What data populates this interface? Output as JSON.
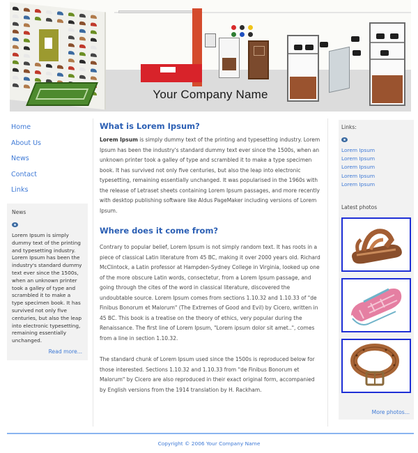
{
  "header": {
    "company_name": "Your Company Name"
  },
  "nav": {
    "items": [
      {
        "label": "Home"
      },
      {
        "label": "About Us"
      },
      {
        "label": "News"
      },
      {
        "label": "Contact"
      },
      {
        "label": "Links"
      }
    ]
  },
  "news_box": {
    "title": "News",
    "icon": "rss-icon",
    "text": "Lorem Ipsum is simply dummy text of the printing and typesetting industry. Lorem Ipsum has been the industry's standard dummy text ever since the 1500s, when an unknown printer took a galley of type and scrambled it to make a type specimen book. It has survived not only five centuries, but also the leap into electronic typesetting, remaining essentially unchanged.",
    "read_more": "Read more..."
  },
  "main": {
    "section1": {
      "heading": "What is Lorem Ipsum?",
      "lead": "Lorem Ipsum",
      "body": " is simply dummy text of the printing and typesetting industry. Lorem Ipsum has been the industry's standard dummy text ever since the 1500s, when an unknown printer took a galley of type and scrambled it to make a type specimen book. It has survived not only five centuries, but also the leap into electronic typesetting, remaining essentially unchanged. It was popularised in the 1960s with the release of Letraset sheets containing Lorem Ipsum passages, and more recently with desktop publishing software like Aldus PageMaker including versions of Lorem Ipsum."
    },
    "section2": {
      "heading": "Where does it come from?",
      "para1": "Contrary to popular belief, Lorem Ipsum is not simply random text. It has roots in a piece of classical Latin literature from 45 BC, making it over 2000 years old. Richard McClintock, a Latin professor at Hampden-Sydney College in Virginia, looked up one of the more obscure Latin words, consectetur, from a Lorem Ipsum passage, and going through the cites of the word in classical literature, discovered the undoubtable source. Lorem Ipsum comes from sections 1.10.32 and 1.10.33 of \"de Finibus Bonorum et Malorum\" (The Extremes of Good and Evil) by Cicero, written in 45 BC. This book is a treatise on the theory of ethics, very popular during the Renaissance. The first line of Lorem Ipsum, \"Lorem ipsum dolor sit amet..\", comes from a line in section 1.10.32.",
      "para2": "The standard chunk of Lorem Ipsum used since the 1500s is reproduced below for those interested. Sections 1.10.32 and 1.10.33 from \"de Finibus Bonorum et Malorum\" by Cicero are also reproduced in their exact original form, accompanied by English versions from the 1914 translation by H. Rackham."
    }
  },
  "right": {
    "links_title": "Links:",
    "links": [
      "Lorem Ipsum",
      "Lorem Ipsum",
      "Lorem Ipsum",
      "Lorem Ipsum",
      "Lorem Ipsum"
    ],
    "photos_title": "Latest photos",
    "photos": [
      {
        "subject": "brown sandal"
      },
      {
        "subject": "pink plaid sneaker"
      },
      {
        "subject": "brown belt"
      }
    ],
    "more_photos": "More photos..."
  },
  "footer": {
    "copyright": "Copyright © 2006 Your Company Name"
  },
  "colors": {
    "link": "#3f7ad6",
    "heading": "#2b5fb4",
    "photo_border": "#1e2fd6",
    "footer_line": "#8ab4f0"
  }
}
